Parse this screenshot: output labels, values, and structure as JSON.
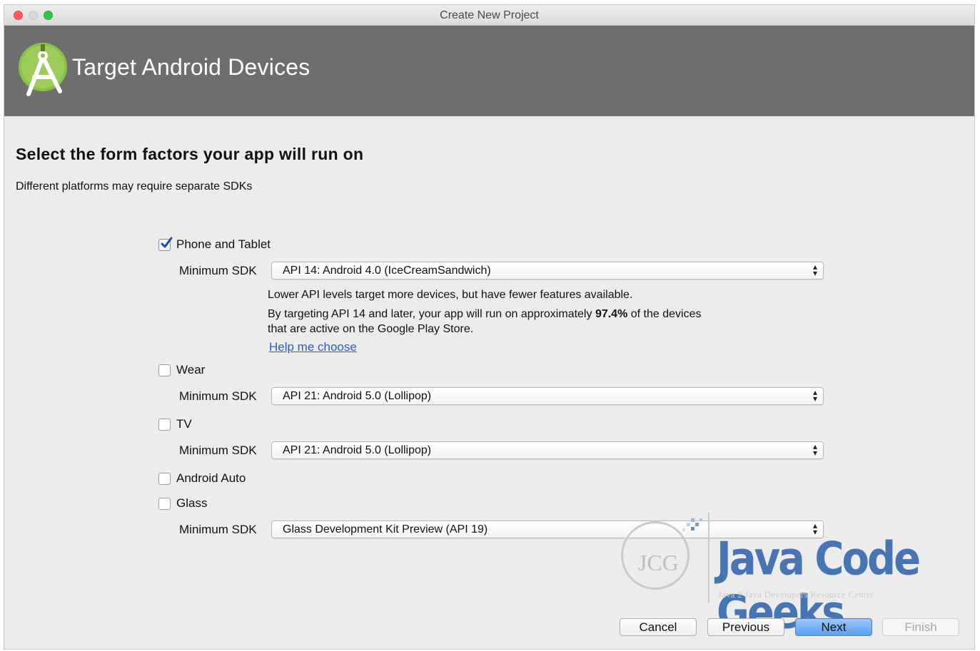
{
  "window": {
    "title": "Create New Project"
  },
  "header": {
    "title": "Target Android Devices"
  },
  "section": {
    "title": "Select the form factors your app will run on",
    "subtitle": "Different platforms may require separate SDKs"
  },
  "phone": {
    "label": "Phone and Tablet",
    "checked": true,
    "sdk_label": "Minimum SDK",
    "sdk_value": "API 14: Android 4.0 (IceCreamSandwich)",
    "info_1": "Lower API levels target more devices, but have fewer features available.",
    "info_2_pre": "By targeting API 14 and later, your app will run on approximately ",
    "info_2_pct": "97.4%",
    "info_2_post": " of the devices",
    "info_3": "that are active on the Google Play Store.",
    "help_link": "Help me choose"
  },
  "wear": {
    "label": "Wear",
    "checked": false,
    "sdk_label": "Minimum SDK",
    "sdk_value": "API 21: Android 5.0 (Lollipop)"
  },
  "tv": {
    "label": "TV",
    "checked": false,
    "sdk_label": "Minimum SDK",
    "sdk_value": "API 21: Android 5.0 (Lollipop)"
  },
  "auto": {
    "label": "Android Auto",
    "checked": false
  },
  "glass": {
    "label": "Glass",
    "checked": false,
    "sdk_label": "Minimum SDK",
    "sdk_value": "Glass Development Kit Preview (API 19)"
  },
  "buttons": {
    "cancel": "Cancel",
    "previous": "Previous",
    "next": "Next",
    "finish": "Finish"
  },
  "watermark": {
    "logo_text": "JCG",
    "title": "Java Code Geeks",
    "subtitle": "Java 2 Java Developers Resource Center"
  },
  "colors": {
    "header_bg": "#6e6e6e",
    "android_green": "#8ac249",
    "link": "#2a5bd7",
    "next_button": "#5a9ff2"
  }
}
